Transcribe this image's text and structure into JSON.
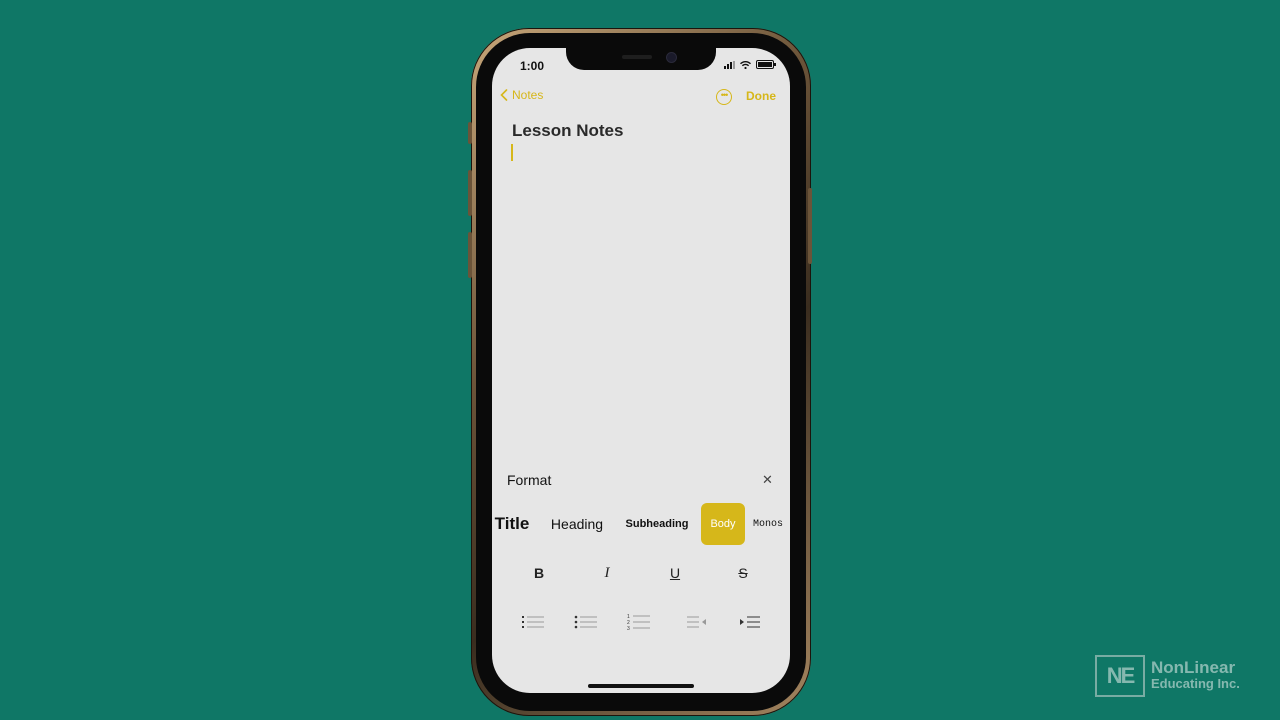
{
  "status_bar": {
    "time": "1:00"
  },
  "nav": {
    "back_label": "Notes",
    "done_label": "Done"
  },
  "note": {
    "title": "Lesson Notes"
  },
  "format_panel": {
    "header": "Format",
    "close_symbol": "✕",
    "styles": [
      {
        "label": "Title"
      },
      {
        "label": "Heading"
      },
      {
        "label": "Subheading"
      },
      {
        "label": "Body",
        "selected": true
      },
      {
        "label": "Monos"
      }
    ],
    "text_styles": {
      "bold": "B",
      "italic": "I",
      "underline": "U",
      "strikethrough": "S"
    },
    "list_buttons": [
      "dashed-list-icon",
      "bulleted-list-icon",
      "numbered-list-icon",
      "outdent-icon",
      "indent-icon"
    ]
  },
  "colors": {
    "accent": "#d6b71a",
    "background": "#0f7766",
    "screen": "#e6e6e6"
  },
  "watermark": {
    "logo": "NE",
    "line1": "NonLinear",
    "line2": "Educating Inc."
  }
}
